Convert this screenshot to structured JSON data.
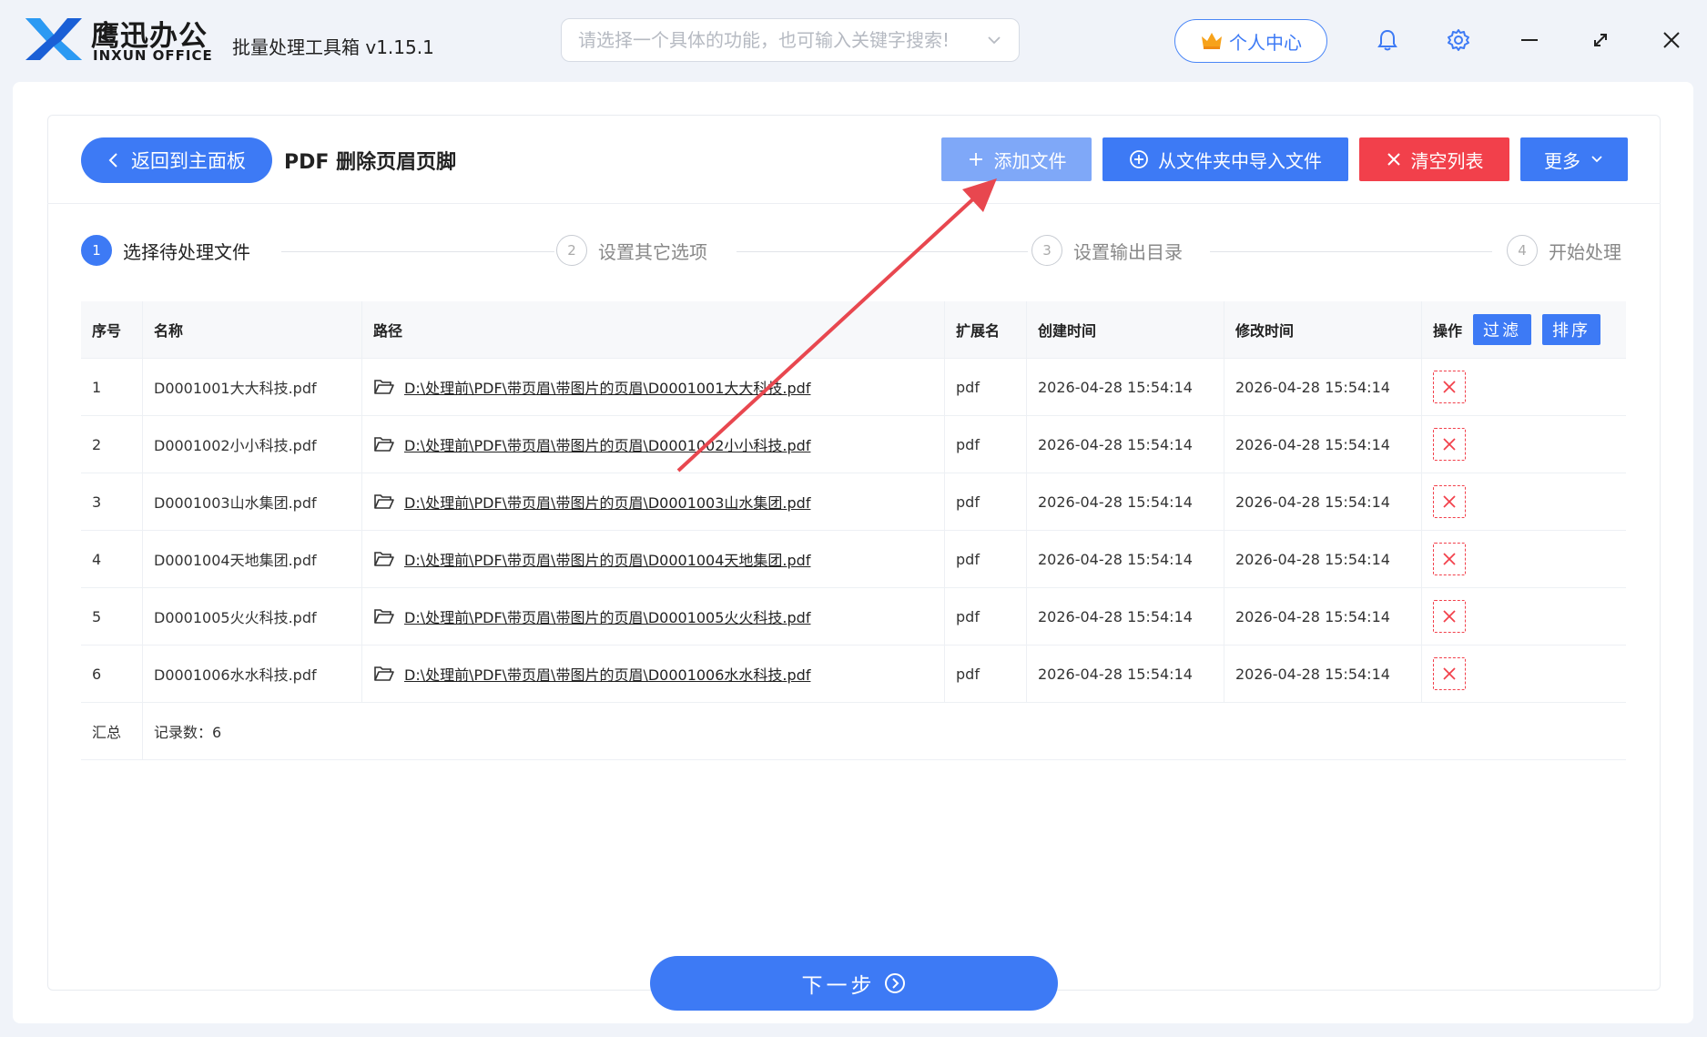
{
  "titlebar": {
    "brand_cn": "鹰迅办公",
    "brand_en": "INXUN OFFICE",
    "app_name": "批量处理工具箱 v1.15.1",
    "search_placeholder": "请选择一个具体的功能，也可输入关键字搜索!",
    "user_center": "个人中心"
  },
  "toolbar": {
    "back_label": "返回到主面板",
    "page_title": "PDF 删除页眉页脚",
    "add_file": "添加文件",
    "import_folder": "从文件夹中导入文件",
    "clear_list": "清空列表",
    "more": "更多"
  },
  "steps": [
    {
      "num": "1",
      "label": "选择待处理文件",
      "active": true
    },
    {
      "num": "2",
      "label": "设置其它选项",
      "active": false
    },
    {
      "num": "3",
      "label": "设置输出目录",
      "active": false
    },
    {
      "num": "4",
      "label": "开始处理",
      "active": false
    }
  ],
  "table": {
    "headers": {
      "idx": "序号",
      "name": "名称",
      "path": "路径",
      "ext": "扩展名",
      "ctime": "创建时间",
      "mtime": "修改时间",
      "op": "操作",
      "filter": "过滤",
      "sort": "排序"
    },
    "rows": [
      {
        "idx": "1",
        "name": "D0001001大大科技.pdf",
        "path": "D:\\处理前\\PDF\\带页眉\\带图片的页眉\\D0001001大大科技.pdf",
        "ext": "pdf",
        "ctime": "2026-04-28 15:54:14",
        "mtime": "2026-04-28 15:54:14"
      },
      {
        "idx": "2",
        "name": "D0001002小小科技.pdf",
        "path": "D:\\处理前\\PDF\\带页眉\\带图片的页眉\\D0001002小小科技.pdf",
        "ext": "pdf",
        "ctime": "2026-04-28 15:54:14",
        "mtime": "2026-04-28 15:54:14"
      },
      {
        "idx": "3",
        "name": "D0001003山水集团.pdf",
        "path": "D:\\处理前\\PDF\\带页眉\\带图片的页眉\\D0001003山水集团.pdf",
        "ext": "pdf",
        "ctime": "2026-04-28 15:54:14",
        "mtime": "2026-04-28 15:54:14"
      },
      {
        "idx": "4",
        "name": "D0001004天地集团.pdf",
        "path": "D:\\处理前\\PDF\\带页眉\\带图片的页眉\\D0001004天地集团.pdf",
        "ext": "pdf",
        "ctime": "2026-04-28 15:54:14",
        "mtime": "2026-04-28 15:54:14"
      },
      {
        "idx": "5",
        "name": "D0001005火火科技.pdf",
        "path": "D:\\处理前\\PDF\\带页眉\\带图片的页眉\\D0001005火火科技.pdf",
        "ext": "pdf",
        "ctime": "2026-04-28 15:54:14",
        "mtime": "2026-04-28 15:54:14"
      },
      {
        "idx": "6",
        "name": "D0001006水水科技.pdf",
        "path": "D:\\处理前\\PDF\\带页眉\\带图片的页眉\\D0001006水水科技.pdf",
        "ext": "pdf",
        "ctime": "2026-04-28 15:54:14",
        "mtime": "2026-04-28 15:54:14"
      }
    ],
    "summary_label": "汇总",
    "record_count": "记录数：6"
  },
  "footer": {
    "next_label": "下一步"
  },
  "colors": {
    "primary": "#3d7af5",
    "primary_light": "#7fa8f8",
    "danger": "#f2404b"
  },
  "icons": [
    "logo-x-icon",
    "chevron-down-icon",
    "crown-icon",
    "bell-icon",
    "gear-icon",
    "minimize-icon",
    "maximize-icon",
    "close-icon",
    "chevron-left-icon",
    "plus-icon",
    "plus-circle-icon",
    "x-icon",
    "folder-open-icon",
    "delete-x-icon",
    "arrow-right-circle-icon"
  ]
}
